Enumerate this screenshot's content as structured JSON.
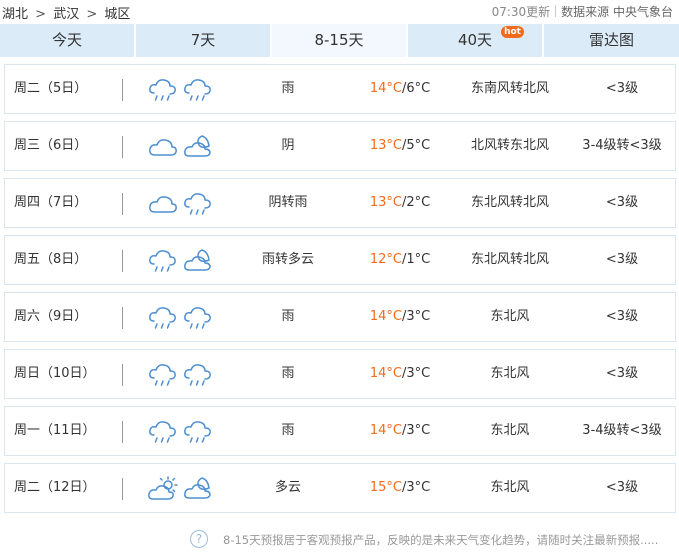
{
  "breadcrumb": [
    "湖北",
    "武汉",
    "城区"
  ],
  "breadcrumb_separator": ">",
  "source": {
    "update_time": "07:30更新",
    "label": "数据来源 中央气象台"
  },
  "tabs": [
    {
      "label": "今天",
      "width": 134
    },
    {
      "label": "7天",
      "width": 134
    },
    {
      "label": "8-15天",
      "width": 134,
      "active": true
    },
    {
      "label": "40天",
      "width": 134,
      "badge": "hot"
    },
    {
      "label": "雷达图",
      "width": 135
    }
  ],
  "forecast": [
    {
      "day": "周二（5日）",
      "icons": [
        "rain-cloud-icon",
        "rain-cloud-icon"
      ],
      "cond": "雨",
      "high": "14°C",
      "low": "/6°C",
      "wind": "东南风转北风",
      "level": "<3级"
    },
    {
      "day": "周三（6日）",
      "icons": [
        "overcast-cloud-icon",
        "partly-cloudy-night-icon"
      ],
      "cond": "阴",
      "high": "13°C",
      "low": "/5°C",
      "wind": "北风转东北风",
      "level": "3-4级转<3级"
    },
    {
      "day": "周四（7日）",
      "icons": [
        "overcast-cloud-icon",
        "rain-cloud-icon"
      ],
      "cond": "阴转雨",
      "high": "13°C",
      "low": "/2°C",
      "wind": "东北风转北风",
      "level": "<3级"
    },
    {
      "day": "周五（8日）",
      "icons": [
        "rain-cloud-icon",
        "partly-cloudy-night-icon"
      ],
      "cond": "雨转多云",
      "high": "12°C",
      "low": "/1°C",
      "wind": "东北风转北风",
      "level": "<3级"
    },
    {
      "day": "周六（9日）",
      "icons": [
        "rain-cloud-icon",
        "rain-cloud-icon"
      ],
      "cond": "雨",
      "high": "14°C",
      "low": "/3°C",
      "wind": "东北风",
      "level": "<3级"
    },
    {
      "day": "周日（10日）",
      "icons": [
        "rain-cloud-icon",
        "rain-cloud-icon"
      ],
      "cond": "雨",
      "high": "14°C",
      "low": "/3°C",
      "wind": "东北风",
      "level": "<3级"
    },
    {
      "day": "周一（11日）",
      "icons": [
        "rain-cloud-icon",
        "rain-cloud-icon"
      ],
      "cond": "雨",
      "high": "14°C",
      "low": "/3°C",
      "wind": "东北风",
      "level": "3-4级转<3级"
    },
    {
      "day": "周二（12日）",
      "icons": [
        "partly-cloudy-day-icon",
        "partly-cloudy-night-icon"
      ],
      "cond": "多云",
      "high": "15°C",
      "low": "/3°C",
      "wind": "东北风",
      "level": "<3级"
    }
  ],
  "footer": {
    "help_icon": "?",
    "note": "8-15天预报居于客观预报产品，反映的是未来天气变化趋势，请随时关注最新预报....."
  },
  "colors": {
    "accent": "#f26b1d",
    "icon": "#4d8fd0",
    "tab_bg": "#dcebf8",
    "tab_active_bg": "#f2f8fd"
  }
}
